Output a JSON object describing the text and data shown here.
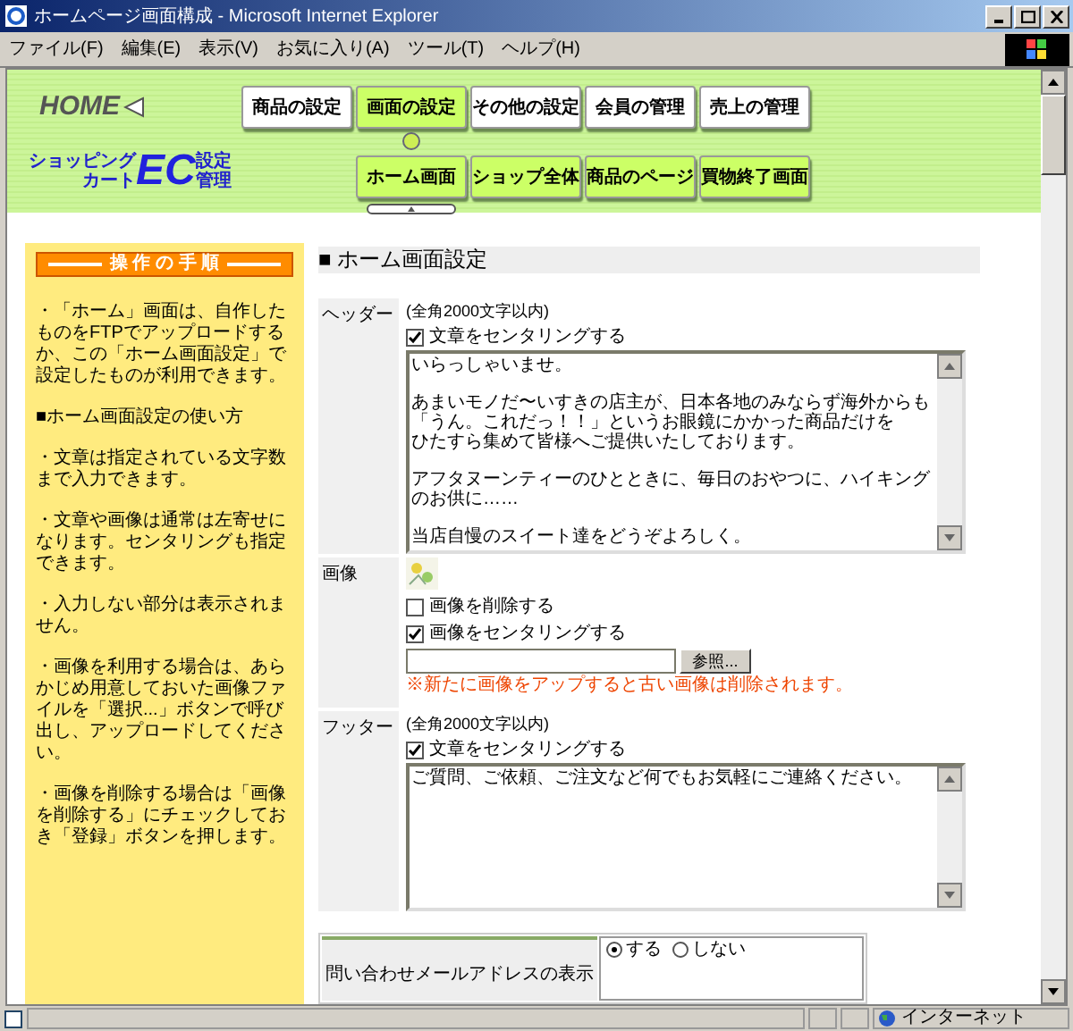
{
  "window": {
    "title": "ホームページ画面構成 - Microsoft Internet Explorer"
  },
  "menu": [
    "ファイル(F)",
    "編集(E)",
    "表示(V)",
    "お気に入り(A)",
    "ツール(T)",
    "ヘルプ(H)"
  ],
  "home": {
    "label": "HOME"
  },
  "logo": {
    "small": [
      "ショッピング",
      "カート"
    ],
    "mark": "EC",
    "side": [
      "設定",
      "管理"
    ]
  },
  "main_tabs": [
    {
      "label": "商品の設定",
      "selected": false
    },
    {
      "label": "画面の設定",
      "selected": true
    },
    {
      "label": "その他の設定",
      "selected": false
    },
    {
      "label": "会員の管理",
      "selected": false
    },
    {
      "label": "売上の管理",
      "selected": false
    }
  ],
  "sub_tabs": [
    {
      "label": "ホーム画面",
      "selected": true
    },
    {
      "label": "ショップ全体",
      "selected": false
    },
    {
      "label": "商品のページ",
      "selected": false
    },
    {
      "label": "買物終了画面",
      "selected": false
    }
  ],
  "sidebar": {
    "title": "操 作 の 手 順",
    "paragraphs": [
      "・「ホーム」画面は、自作したものをFTPでアップロードするか、この「ホーム画面設定」で設定したものが利用できます。",
      "■ホーム画面設定の使い方",
      "・文章は指定されている文字数まで入力できます。",
      "・文章や画像は通常は左寄せになります。センタリングも指定できます。",
      "・入力しない部分は表示されません。",
      "・画像を利用する場合は、あらかじめ用意しておいた画像ファイルを「選択...」ボタンで呼び出し、アップロードしてください。",
      "・画像を削除する場合は「画像を削除する」にチェックしておき「登録」ボタンを押します。"
    ]
  },
  "section_title": "■ ホーム画面設定",
  "header": {
    "label": "ヘッダー",
    "note": "(全角2000文字以内)",
    "center": {
      "label": "文章をセンタリングする",
      "checked": true
    },
    "text": [
      [
        "いらっしゃいませ。"
      ],
      [
        "あまいモノだ〜いすきの店主が、日本各地のみならず海外からも",
        "「うん。これだっ！！」というお眼鏡にかかった商品だけを",
        "ひたすら集めて皆様へご提供いたしております。"
      ],
      [
        "アフタヌーンティーのひとときに、毎日のおやつに、ハイキングのお供に……"
      ],
      [
        "当店自慢のスイート達をどうぞよろしく。"
      ]
    ]
  },
  "image": {
    "label": "画像",
    "delete": {
      "label": "画像を削除する",
      "checked": false
    },
    "center": {
      "label": "画像をセンタリングする",
      "checked": true
    },
    "browse_button": "参照...",
    "warning": "※新たに画像をアップすると古い画像は削除されます。"
  },
  "footer": {
    "label": "フッター",
    "note": "(全角2000文字以内)",
    "center": {
      "label": "文章をセンタリングする",
      "checked": true
    },
    "text": [
      [
        "ご質問、ご依頼、ご注文など何でもお気軽にご連絡ください。"
      ]
    ]
  },
  "contact": {
    "label": "問い合わせメールアドレスの表示",
    "options": [
      {
        "label": "する",
        "selected": true
      },
      {
        "label": "しない",
        "selected": false
      }
    ]
  },
  "status_bar": {
    "zone": "インターネット"
  }
}
